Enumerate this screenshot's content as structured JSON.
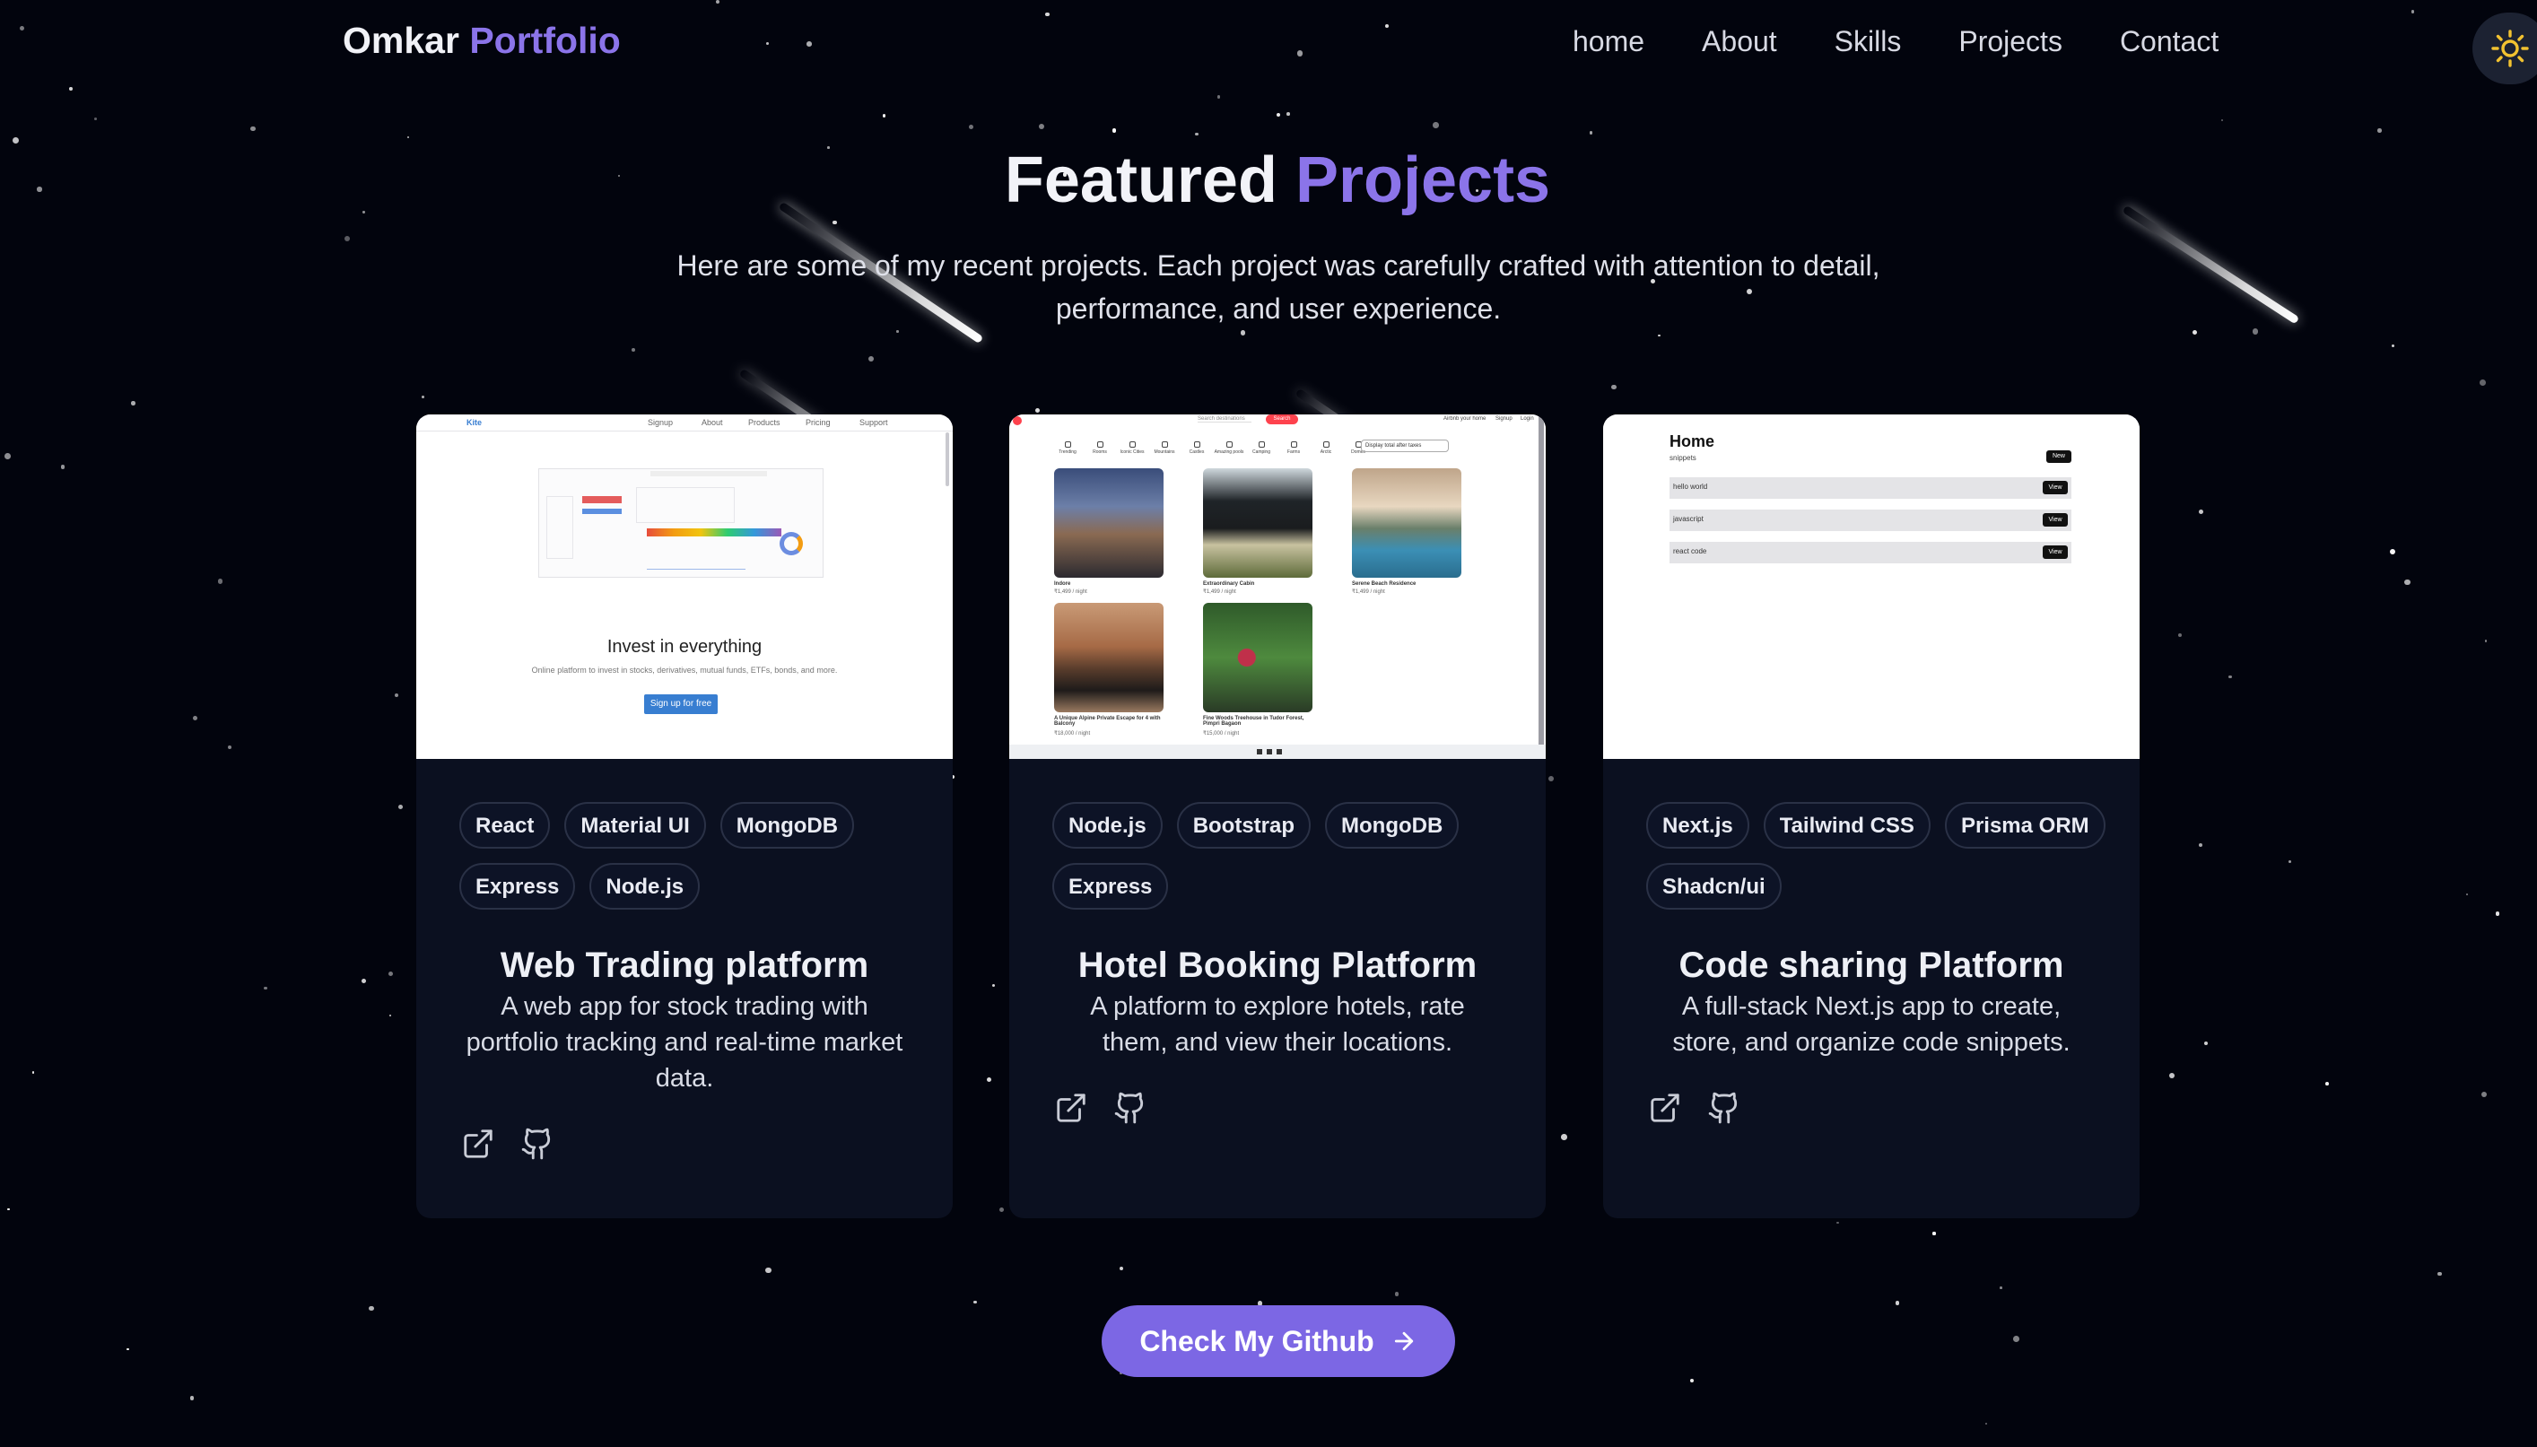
{
  "nav": {
    "brand_first": "Omkar",
    "brand_second": "Portfolio",
    "links": [
      "home",
      "About",
      "Skills",
      "Projects",
      "Contact"
    ],
    "theme_icon": "sun-icon"
  },
  "header": {
    "title_first": "Featured",
    "title_second": "Projects",
    "subtitle": "Here are some of my recent projects. Each project was carefully crafted with attention to detail, performance, and user experience."
  },
  "projects": [
    {
      "title": "Web Trading platform",
      "description": "A web app for stock trading with portfolio tracking and real-time market data.",
      "tags": [
        "React",
        "Material UI",
        "MongoDB",
        "Express",
        "Node.js"
      ],
      "preview": {
        "logo": "Kite",
        "nav": [
          "Signup",
          "About",
          "Products",
          "Pricing",
          "Support"
        ],
        "headline": "Invest in everything",
        "tagline": "Online platform to invest in stocks, derivatives, mutual funds, ETFs, bonds, and more.",
        "cta": "Sign up for free"
      }
    },
    {
      "title": "Hotel Booking Platform",
      "description": "A platform to explore hotels, rate them, and view their locations.",
      "tags": [
        "Node.js",
        "Bootstrap",
        "MongoDB",
        "Express"
      ],
      "preview": {
        "search_placeholder": "Search destinations",
        "search_button": "Search",
        "filter": "Display total after taxes",
        "nav": [
          "Airbnb your home",
          "Signup",
          "Login"
        ],
        "categories": [
          "Trending",
          "Rooms",
          "Iconic Cities",
          "Mountains",
          "Castles",
          "Amazing pools",
          "Camping",
          "Farms",
          "Arctic",
          "Domes"
        ],
        "listings": [
          {
            "name": "Indore",
            "price": "₹1,499 / night"
          },
          {
            "name": "Extraordinary Cabin",
            "price": "₹1,499 / night"
          },
          {
            "name": "Serene Beach Residence",
            "price": "₹1,499 / night"
          },
          {
            "name": "A Unique Alpine Private Escape for 4 with Balcony",
            "price": "₹18,000 / night"
          },
          {
            "name": "Fine Woods Treehouse in Tudor Forest, Pimpri Bagaon",
            "price": "₹15,000 / night"
          }
        ]
      }
    },
    {
      "title": "Code sharing Platform",
      "description": "A full-stack Next.js app to create, store, and organize code snippets.",
      "tags": [
        "Next.js",
        "Tailwind CSS",
        "Prisma ORM",
        "Shadcn/ui"
      ],
      "preview": {
        "heading": "Home",
        "subheading": "snippets",
        "new_button": "New",
        "snippets": [
          "hello world",
          "javascript",
          "react code"
        ],
        "view_button": "View"
      }
    }
  ],
  "cta": {
    "label": "Check My Github"
  },
  "colors": {
    "background": "#02040d",
    "accent": "#8b74e9",
    "card": "#0b1020",
    "button": "#7c67e4"
  }
}
